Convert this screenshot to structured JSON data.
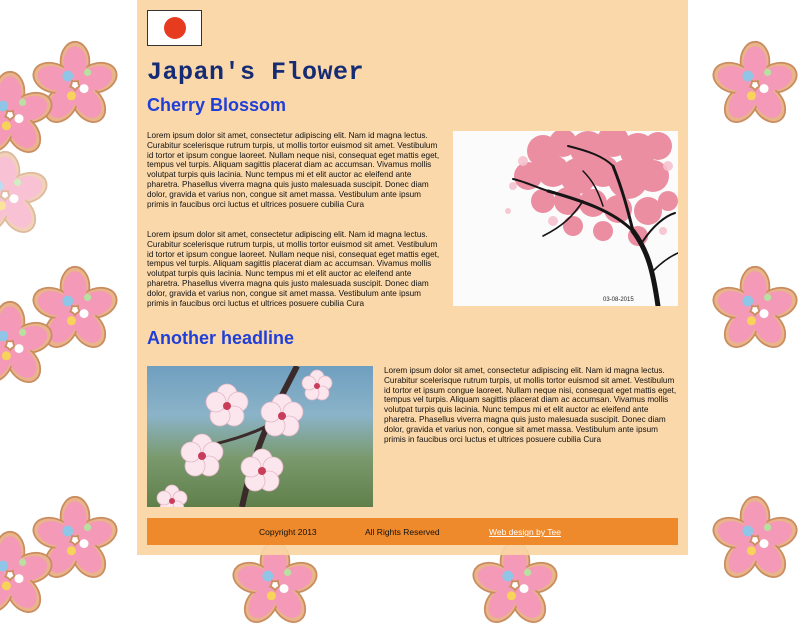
{
  "site": {
    "title": "Japan's Flower",
    "flag_icon": "japan-flag-icon",
    "colors": {
      "page_bg": "#fbd5a4",
      "title": "#152c74",
      "headline": "#1f3fd8",
      "footer_bg": "#ef8a2c",
      "flag_sun": "#e63b1f"
    }
  },
  "section1": {
    "headline": "Cherry Blossom",
    "paragraph1": "Lorem ipsum dolor sit amet, consectetur adipiscing elit. Nam id magna lectus. Curabitur scelerisque rutrum turpis, ut mollis tortor euismod sit amet. Vestibulum id tortor et ipsum congue laoreet. Nullam neque nisi, consequat eget mattis eget, tempus vel turpis. Aliquam sagittis placerat diam ac accumsan. Vivamus mollis volutpat turpis quis lacinia. Nunc tempus mi et elit auctor ac eleifend ante pharetra. Phasellus viverra magna quis justo malesuada suscipit. Donec diam dolor, gravida et varius non, congue sit amet massa. Vestibulum ante ipsum primis in faucibus orci luctus et ultrices posuere cubilia Cura",
    "paragraph2": "Lorem ipsum dolor sit amet, consectetur adipiscing elit. Nam id magna lectus. Curabitur scelerisque rutrum turpis, ut mollis tortor euismod sit amet. Vestibulum id tortor et ipsum congue laoreet. Nullam neque nisi, consequat eget mattis eget, tempus vel turpis. Aliquam sagittis placerat diam ac accumsan. Vivamus mollis volutpat turpis quis lacinia. Nunc tempus mi et elit auctor ac eleifend ante pharetra. Phasellus viverra magna quis justo malesuada suscipit. Donec diam dolor, gravida et varius non, congue sit amet massa. Vestibulum ante ipsum primis in faucibus orci luctus et ultrices posuere cubilia Cura",
    "image": "cherry-tree-painting",
    "image_signature": "03-08-2015"
  },
  "section2": {
    "headline": "Another headline",
    "paragraph": "Lorem ipsum dolor sit amet, consectetur adipiscing elit. Nam id magna lectus. Curabitur scelerisque rutrum turpis, ut mollis tortor euismod sit amet. Vestibulum id tortor et ipsum congue laoreet. Nullam neque nisi, consequat eget mattis eget, tempus vel turpis. Aliquam sagittis placerat diam ac accumsan. Vivamus mollis volutpat turpis quis lacinia. Nunc tempus mi et elit auctor ac eleifend ante pharetra. Phasellus viverra magna quis justo malesuada suscipit. Donec diam dolor, gravida et varius non, congue sit amet massa. Vestibulum ante ipsum primis in faucibus orci luctus et ultrices posuere cubilia Cura",
    "image": "cherry-blossom-photo"
  },
  "footer": {
    "copyright": "Copyright 2013",
    "rights": "All Rights Reserved",
    "credit_link": "Web design by Tee"
  }
}
